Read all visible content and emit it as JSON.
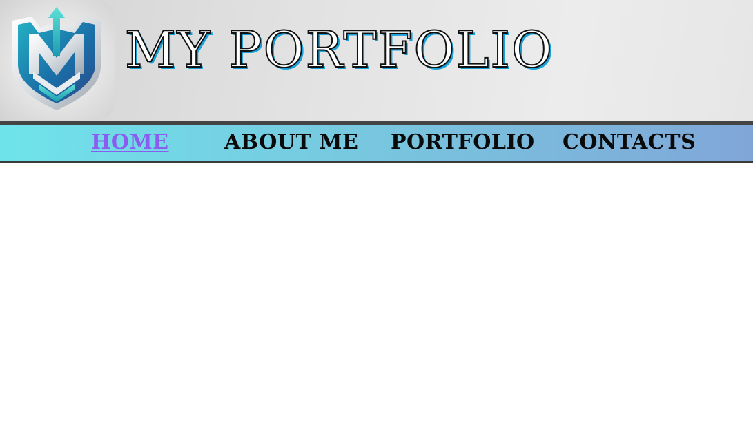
{
  "header": {
    "logo_name": "shield-emblem-logo",
    "title": "MY PORTFOLIO",
    "title_color": "#ffffff",
    "title_outline_color": "#111111",
    "title_shadow_color": "#1aa0d8"
  },
  "nav": {
    "active_color": "#8a5cf0",
    "gradient_start": "#6fe3ea",
    "gradient_end": "#80a6d8",
    "items": [
      {
        "label": "HOME",
        "active": true
      },
      {
        "label": "ABOUT ME",
        "active": false
      },
      {
        "label": "PORTFOLIO",
        "active": false
      },
      {
        "label": "CONTACTS",
        "active": false
      }
    ]
  }
}
